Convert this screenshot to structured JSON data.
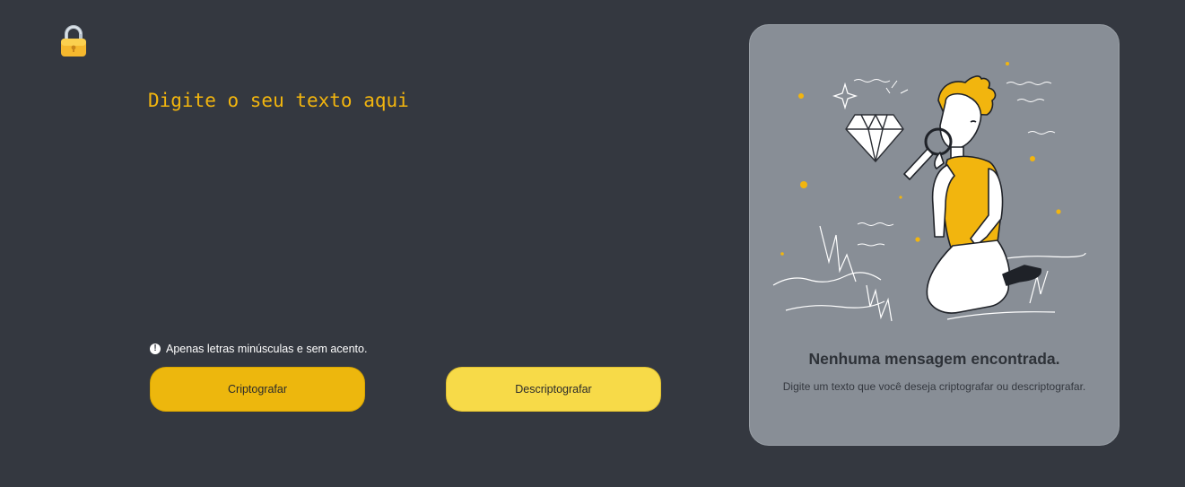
{
  "app": {
    "logo_icon": "lock-icon"
  },
  "input": {
    "placeholder": "Digite o seu texto aqui",
    "value": ""
  },
  "hint": {
    "icon": "exclamation-circle-icon",
    "text": "Apenas letras minúsculas e sem acento."
  },
  "buttons": {
    "encrypt_label": "Criptografar",
    "decrypt_label": "Descriptografar"
  },
  "output": {
    "illustration": "person-magnifying-diamond",
    "title": "Nenhuma mensagem encontrada.",
    "subtitle": "Digite um texto que você deseja criptografar ou descriptografar."
  },
  "colors": {
    "background": "#343840",
    "accent": "#F2B50E",
    "encrypt_button": "#EDB70D",
    "decrypt_button": "#F7DA48",
    "panel": "#888E96"
  }
}
